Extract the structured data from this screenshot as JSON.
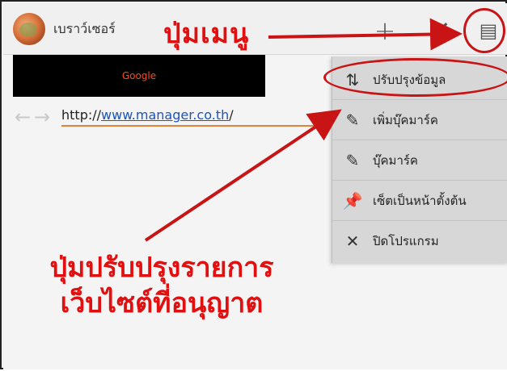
{
  "actionbar": {
    "app_title": "เบราว์เซอร์",
    "callout_menu": "ปุ่มเมนู",
    "plus_glyph": "+",
    "close_glyph": "✕",
    "menu_glyph": "▤"
  },
  "page": {
    "google_label": "Google",
    "back_glyph": "←",
    "forward_glyph": "→",
    "url_prefix": "http://",
    "url_link": "www.manager.co.th",
    "url_suffix": "/"
  },
  "menu": {
    "items": [
      {
        "icon": "⇅",
        "label": "ปรับปรุงข้อมูล"
      },
      {
        "icon": "✎",
        "label": "เพิ่มบุ๊คมาร์ค"
      },
      {
        "icon": "✎",
        "label": "บุ๊คมาร์ค"
      },
      {
        "icon": "📌",
        "label": "เซ็ตเป็นหน้าตั้งต้น"
      },
      {
        "icon": "✕",
        "label": "ปิดโปรแกรม"
      }
    ]
  },
  "callout_bottom": {
    "line1": "ปุ่มปรับปรุงรายการ",
    "line2": "เว็บไซต์ที่อนุญาต"
  },
  "colors": {
    "annotation_red": "#e01010",
    "menu_bg": "#d7d7d7",
    "banner_bg": "#000000",
    "url_underline": "#e0843c"
  }
}
